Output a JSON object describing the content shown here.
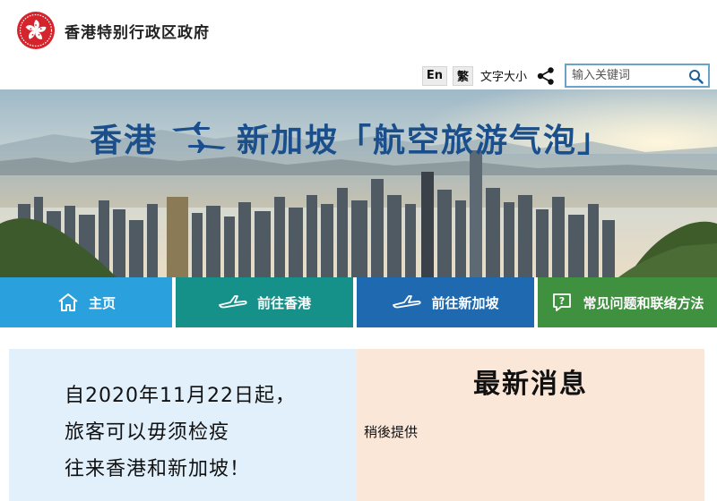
{
  "header": {
    "site_title": "香港特别行政区政府",
    "logo_icon": "hksar-bauhinia-emblem-icon"
  },
  "toolbar": {
    "lang_en": "En",
    "lang_trad": "繁",
    "font_size": "文字大小",
    "share_icon": "share-icon",
    "search_placeholder": "输入关键词",
    "search_icon": "search-icon"
  },
  "banner": {
    "title_left": "香港",
    "title_right": "新加坡「航空旅游气泡」",
    "planes_icon": "airplanes-icon"
  },
  "nav": {
    "items": [
      {
        "label": "主页",
        "icon": "home-icon",
        "color": "#2aa1dc"
      },
      {
        "label": "前往香港",
        "icon": "airplane-icon",
        "color": "#16918a"
      },
      {
        "label": "前往新加坡",
        "icon": "airplane-icon",
        "color": "#1f69b1"
      },
      {
        "label": "常见问题和联络方法",
        "icon": "faq-icon",
        "color": "#3f9140"
      }
    ]
  },
  "notice": {
    "lines": [
      "自2020年11月22日起，",
      "旅客可以毋须检疫",
      "往来香港和新加坡！"
    ]
  },
  "news": {
    "heading": "最新消息",
    "body": "稍後提供"
  },
  "colors": {
    "banner_title": "#1a4f8c",
    "notice_bg": "#e1f0fb",
    "news_bg": "#fbe7d8",
    "search_border": "#6aa3c9"
  }
}
